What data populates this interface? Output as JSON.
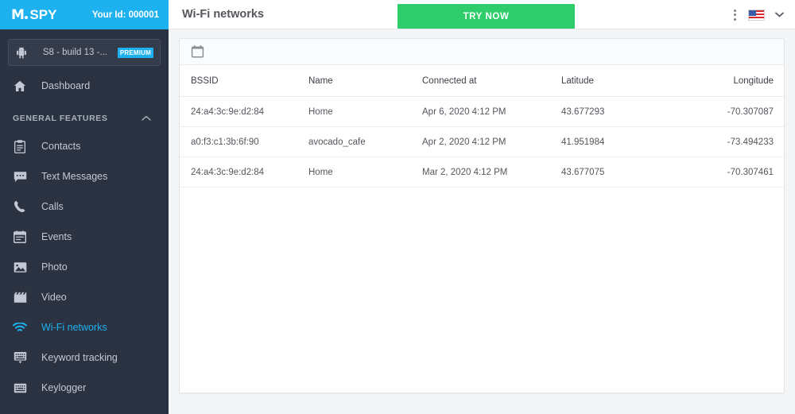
{
  "brand": {
    "logo_m": "M",
    "logo_spy": "SPY",
    "your_id": "Your Id: 000001",
    "accent_color": "#1eb1f0",
    "sidebar_color": "#2b3241"
  },
  "device": {
    "icon": "android-icon",
    "name": "S8 - build 13 -...",
    "badge": "PREMIUM"
  },
  "sidebar": {
    "dashboard": {
      "label": "Dashboard",
      "icon": "home-icon"
    },
    "section": {
      "label": "GENERAL FEATURES",
      "icon": "chevron-up-icon"
    },
    "items": [
      {
        "label": "Contacts",
        "icon": "contacts-icon",
        "active": false
      },
      {
        "label": "Text Messages",
        "icon": "message-icon",
        "active": false
      },
      {
        "label": "Calls",
        "icon": "phone-icon",
        "active": false
      },
      {
        "label": "Events",
        "icon": "calendar-icon",
        "active": false
      },
      {
        "label": "Photo",
        "icon": "photo-icon",
        "active": false
      },
      {
        "label": "Video",
        "icon": "video-icon",
        "active": false
      },
      {
        "label": "Wi-Fi networks",
        "icon": "wifi-icon",
        "active": true
      },
      {
        "label": "Keyword tracking",
        "icon": "keyword-icon",
        "active": false
      },
      {
        "label": "Keylogger",
        "icon": "keyboard-icon",
        "active": false
      }
    ]
  },
  "topbar": {
    "title": "Wi-Fi networks",
    "try_now": "TRY NOW",
    "try_now_color": "#2ecc6b",
    "kebab_icon": "more-vertical-icon",
    "flag_icon": "us-flag-icon",
    "chevron_icon": "chevron-down-icon"
  },
  "toolbar": {
    "calendar_icon": "calendar-icon"
  },
  "table": {
    "columns": [
      "BSSID",
      "Name",
      "Connected at",
      "Latitude",
      "Longitude"
    ],
    "rows": [
      {
        "bssid": "24:a4:3c:9e:d2:84",
        "name": "Home",
        "connected_at": "Apr 6, 2020 4:12 PM",
        "latitude": "43.677293",
        "longitude": "-70.307087"
      },
      {
        "bssid": "a0:f3:c1:3b:6f:90",
        "name": "avocado_cafe",
        "connected_at": "Apr 2, 2020 4:12 PM",
        "latitude": "41.951984",
        "longitude": "-73.494233"
      },
      {
        "bssid": "24:a4:3c:9e:d2:84",
        "name": "Home",
        "connected_at": "Mar 2, 2020 4:12 PM",
        "latitude": "43.677075",
        "longitude": "-70.307461"
      }
    ]
  }
}
